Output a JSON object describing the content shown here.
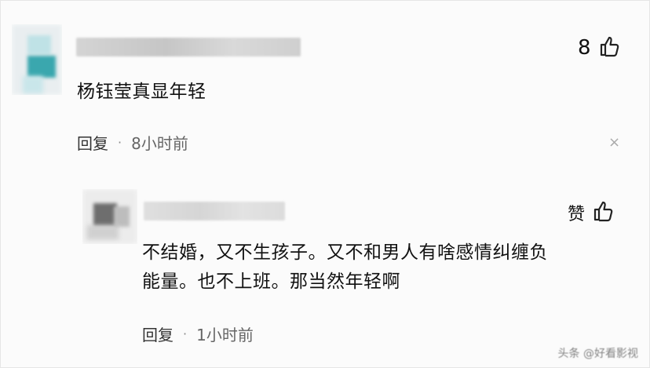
{
  "comments": [
    {
      "text": "杨钰莹真显年轻",
      "likes": "8",
      "reply_label": "回复",
      "separator": "·",
      "time": "8小时前",
      "close_glyph": "×"
    },
    {
      "text_line1": "不结婚，又不生孩子。又不和男人有啥感情纠缠负",
      "text_line2": "能量。也不上班。那当然年轻啊",
      "likes": "赞",
      "reply_label": "回复",
      "separator": "·",
      "time": "1小时前"
    }
  ],
  "watermark": "头条 @好看影视",
  "colors": {
    "accent": "#2d9aa3",
    "text": "#111111",
    "meta": "#666666"
  }
}
